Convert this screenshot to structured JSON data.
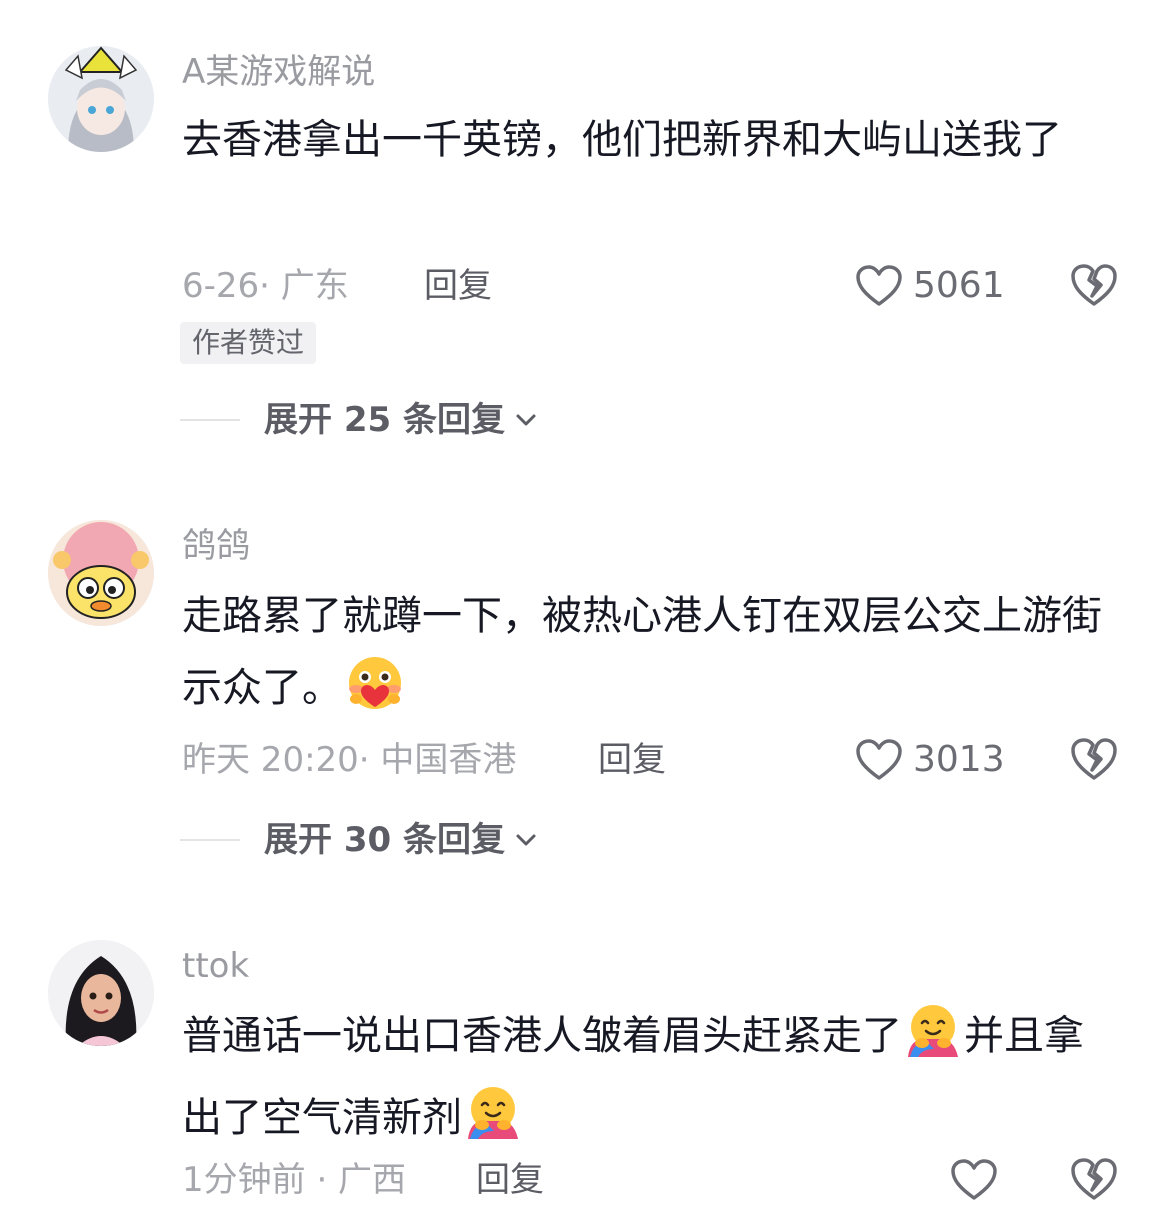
{
  "comments": [
    {
      "username": "A某游戏解说",
      "text": "去香港拿出一千英镑，他们把新界和大屿山送我了",
      "meta": "6-26· 广东",
      "reply_label": "回复",
      "likes": "5061",
      "badge": "作者赞过",
      "expand_label": "展开 25 条回复"
    },
    {
      "username": "鸽鸽",
      "text": "走路累了就蹲一下，被热心港人钉在双层公交上游街示众了。",
      "emoji": "smiling-face-with-heart-emoji",
      "meta": "昨天 20:20· 中国香港",
      "reply_label": "回复",
      "likes": "3013",
      "expand_label": "展开 30 条回复"
    },
    {
      "username": "ttok",
      "text_part1": "普通话一说出口香港人皱着眉头赶紧走了",
      "text_part2": "并且拿出了空气清新剂",
      "emoji": "hugging-face-emoji",
      "meta": "1分钟前 · 广西",
      "reply_label": "回复",
      "likes": ""
    }
  ],
  "colors": {
    "text": "#161823",
    "secondary": "#9a9ba1",
    "icon": "#6b6c73"
  }
}
